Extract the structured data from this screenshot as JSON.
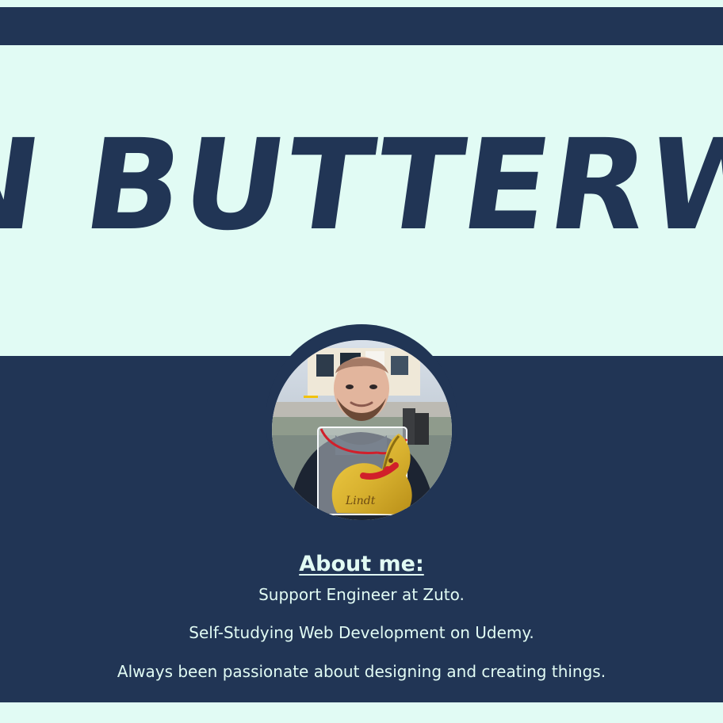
{
  "header": {
    "title": "N BUTTERW"
  },
  "about": {
    "heading": "About me:",
    "lines": [
      "Support Engineer at Zuto.",
      "Self-Studying Web Development on Udemy.",
      "Always been passionate about designing and creating things."
    ]
  },
  "photo": {
    "box_label": "Lindt"
  },
  "colors": {
    "navy": "#213555",
    "mint": "#e1fbf4",
    "gold": "#d8b12f",
    "red_ribbon": "#d11f2a"
  }
}
